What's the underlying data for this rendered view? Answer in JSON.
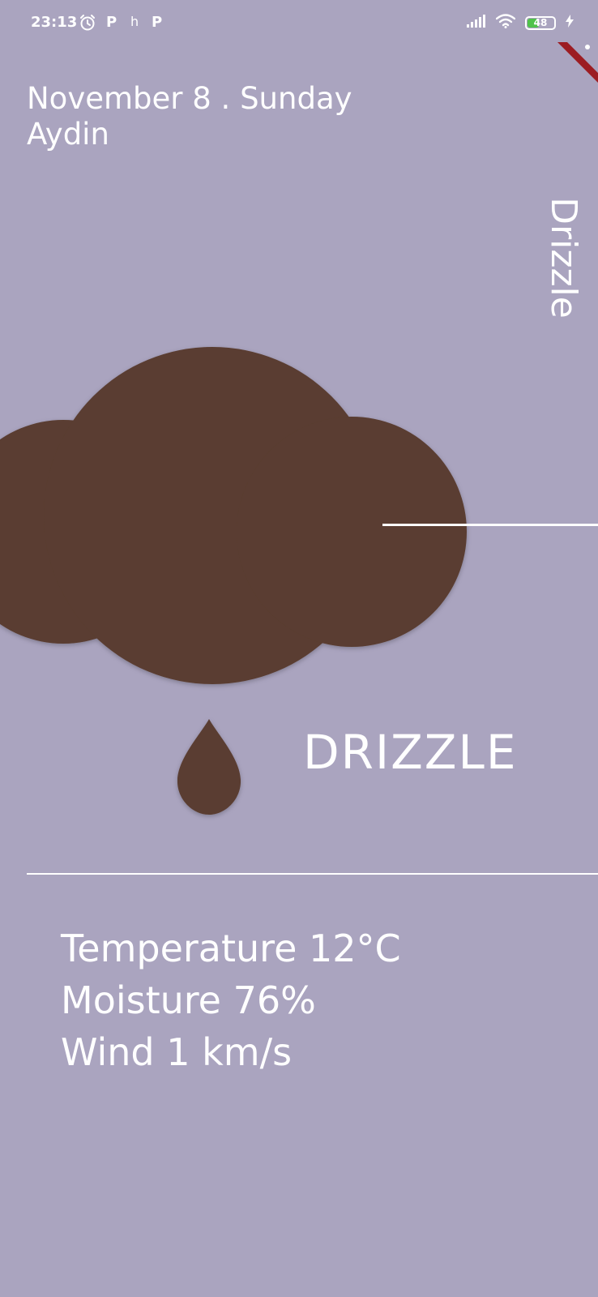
{
  "status_bar": {
    "time": "23:13",
    "notification_icons": [
      "alarm-clock-icon",
      "p-app-icon",
      "h-app-icon",
      "p-app-icon"
    ],
    "glyph_p": "P",
    "glyph_h": "h",
    "battery_level": "48",
    "battery_fraction": 0.48,
    "battery_color": "#4fc24a"
  },
  "weather": {
    "date": "November 8 . Sunday",
    "city": "Aydin",
    "vertical_label": "Drizzle",
    "condition": "DRIZZLE",
    "temperature": "Temperature 12°C",
    "moisture": "Moisture 76%",
    "wind": "Wind 1 km/s"
  },
  "colors": {
    "background": "#aaa4bf",
    "cloud": "#5a3e30",
    "text": "#ffffff",
    "ribbon": "#9c1c22"
  }
}
